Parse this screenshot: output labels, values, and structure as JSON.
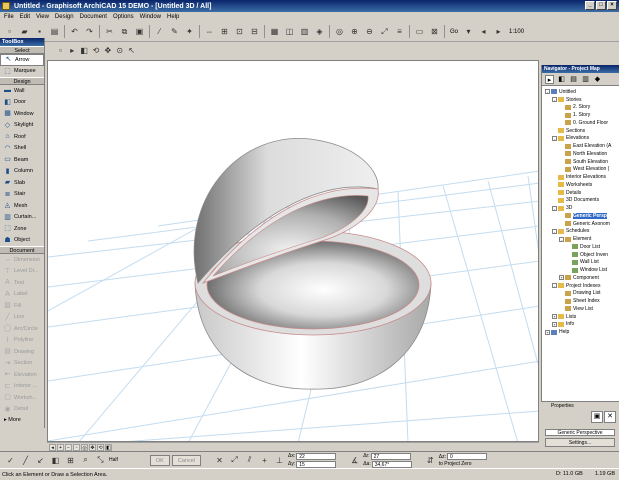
{
  "window": {
    "title": "Untitled - Graphisoft ArchiCAD 15 DEMO - [Untitled 3D / All]",
    "controls": [
      "_",
      "□",
      "×"
    ]
  },
  "menu": [
    "File",
    "Edit",
    "View",
    "Design",
    "Document",
    "Options",
    "Window",
    "Help"
  ],
  "toolbar": {
    "go_label": "Go",
    "zoom_label": "1:100"
  },
  "toolbox": {
    "title": "ToolBox",
    "select_section": "Select",
    "select_items": [
      {
        "label": "Arrow",
        "icon": "arrow-icon"
      },
      {
        "label": "Marquee",
        "icon": "marquee-icon"
      }
    ],
    "design_section": "Design",
    "design_items": [
      {
        "label": "Wall",
        "icon": "wall-icon"
      },
      {
        "label": "Door",
        "icon": "door-icon"
      },
      {
        "label": "Window",
        "icon": "window-icon"
      },
      {
        "label": "Skylight",
        "icon": "skylight-icon"
      },
      {
        "label": "Roof",
        "icon": "roof-icon"
      },
      {
        "label": "Shell",
        "icon": "shell-icon"
      },
      {
        "label": "Beam",
        "icon": "beam-icon"
      },
      {
        "label": "Column",
        "icon": "column-icon"
      },
      {
        "label": "Slab",
        "icon": "slab-icon"
      },
      {
        "label": "Stair",
        "icon": "stair-icon"
      },
      {
        "label": "Mesh",
        "icon": "mesh-icon"
      },
      {
        "label": "Curtain...",
        "icon": "curtain-wall-icon"
      },
      {
        "label": "Zone",
        "icon": "zone-icon"
      },
      {
        "label": "Object",
        "icon": "object-icon"
      }
    ],
    "document_section": "Document",
    "document_items": [
      {
        "label": "Dimension",
        "icon": "dimension-icon"
      },
      {
        "label": "Level Di...",
        "icon": "level-dimension-icon"
      },
      {
        "label": "Text",
        "icon": "text-icon"
      },
      {
        "label": "Label",
        "icon": "label-icon"
      },
      {
        "label": "Fill",
        "icon": "fill-icon"
      },
      {
        "label": "Line",
        "icon": "line-icon"
      },
      {
        "label": "Arc/Circle",
        "icon": "arc-icon"
      },
      {
        "label": "Polyline",
        "icon": "polyline-icon"
      },
      {
        "label": "Drawing",
        "icon": "drawing-icon"
      },
      {
        "label": "Section",
        "icon": "section-icon"
      },
      {
        "label": "Elevation",
        "icon": "elevation-icon"
      },
      {
        "label": "Interior ...",
        "icon": "interior-elevation-icon"
      },
      {
        "label": "Worksh...",
        "icon": "worksheet-icon"
      },
      {
        "label": "Detail",
        "icon": "detail-icon"
      }
    ],
    "more_label": "More"
  },
  "navigator": {
    "title": "Navigator - Project Map",
    "tree": [
      {
        "label": "Untitled",
        "depth": 0,
        "exp": "-"
      },
      {
        "label": "Stories",
        "depth": 1,
        "exp": "-"
      },
      {
        "label": "2. Story",
        "depth": 2,
        "exp": ""
      },
      {
        "label": "1. Story",
        "depth": 2,
        "exp": ""
      },
      {
        "label": "0. Ground Floor",
        "depth": 2,
        "exp": ""
      },
      {
        "label": "Sections",
        "depth": 1,
        "exp": ""
      },
      {
        "label": "Elevations",
        "depth": 1,
        "exp": "-"
      },
      {
        "label": "East Elevation (A",
        "depth": 2,
        "exp": ""
      },
      {
        "label": "North Elevation",
        "depth": 2,
        "exp": ""
      },
      {
        "label": "South Elevation",
        "depth": 2,
        "exp": ""
      },
      {
        "label": "West Elevation (",
        "depth": 2,
        "exp": ""
      },
      {
        "label": "Interior Elevations",
        "depth": 1,
        "exp": ""
      },
      {
        "label": "Worksheets",
        "depth": 1,
        "exp": ""
      },
      {
        "label": "Details",
        "depth": 1,
        "exp": ""
      },
      {
        "label": "3D Documents",
        "depth": 1,
        "exp": ""
      },
      {
        "label": "3D",
        "depth": 1,
        "exp": "-"
      },
      {
        "label": "Generic Persp",
        "depth": 2,
        "exp": "",
        "sel": true
      },
      {
        "label": "Generic Axonom",
        "depth": 2,
        "exp": ""
      },
      {
        "label": "Schedules",
        "depth": 1,
        "exp": "-"
      },
      {
        "label": "Element",
        "depth": 2,
        "exp": "-"
      },
      {
        "label": "Door List",
        "depth": 3,
        "exp": ""
      },
      {
        "label": "Object Inven",
        "depth": 3,
        "exp": ""
      },
      {
        "label": "Wall List",
        "depth": 3,
        "exp": ""
      },
      {
        "label": "Window List",
        "depth": 3,
        "exp": ""
      },
      {
        "label": "Component",
        "depth": 2,
        "exp": "+"
      },
      {
        "label": "Project Indexes",
        "depth": 1,
        "exp": "-"
      },
      {
        "label": "Drawing List",
        "depth": 2,
        "exp": ""
      },
      {
        "label": "Sheet Index",
        "depth": 2,
        "exp": ""
      },
      {
        "label": "View List",
        "depth": 2,
        "exp": ""
      },
      {
        "label": "Lists",
        "depth": 1,
        "exp": "+"
      },
      {
        "label": "Info",
        "depth": 1,
        "exp": "+"
      },
      {
        "label": "Help",
        "depth": 0,
        "exp": "+"
      }
    ],
    "properties_label": "Properties",
    "properties_value": "Generic Perspective",
    "settings_label": "Settings..."
  },
  "infobox": {
    "half_label": "Half",
    "ok_label": "OK",
    "cancel_label": "Cancel",
    "dx_label": "Δx:",
    "dx_value": "22",
    "dy_label": "Δy:",
    "dy_value": "15",
    "r_label": "Δr:",
    "r_value": "27",
    "a_label": "Δa:",
    "a_value": "34,67°",
    "z_label": "Δz:",
    "z_value": "0",
    "z_ref": "to Project Zero"
  },
  "status": {
    "hint": "Click an Element or Draw a Selection Area.",
    "disk": "D: 11.0 GB",
    "memory": "1.19 GB"
  },
  "colors": {
    "titlebar": "#0a246a",
    "chrome": "#d4d0c8",
    "selection": "#316ac5"
  }
}
